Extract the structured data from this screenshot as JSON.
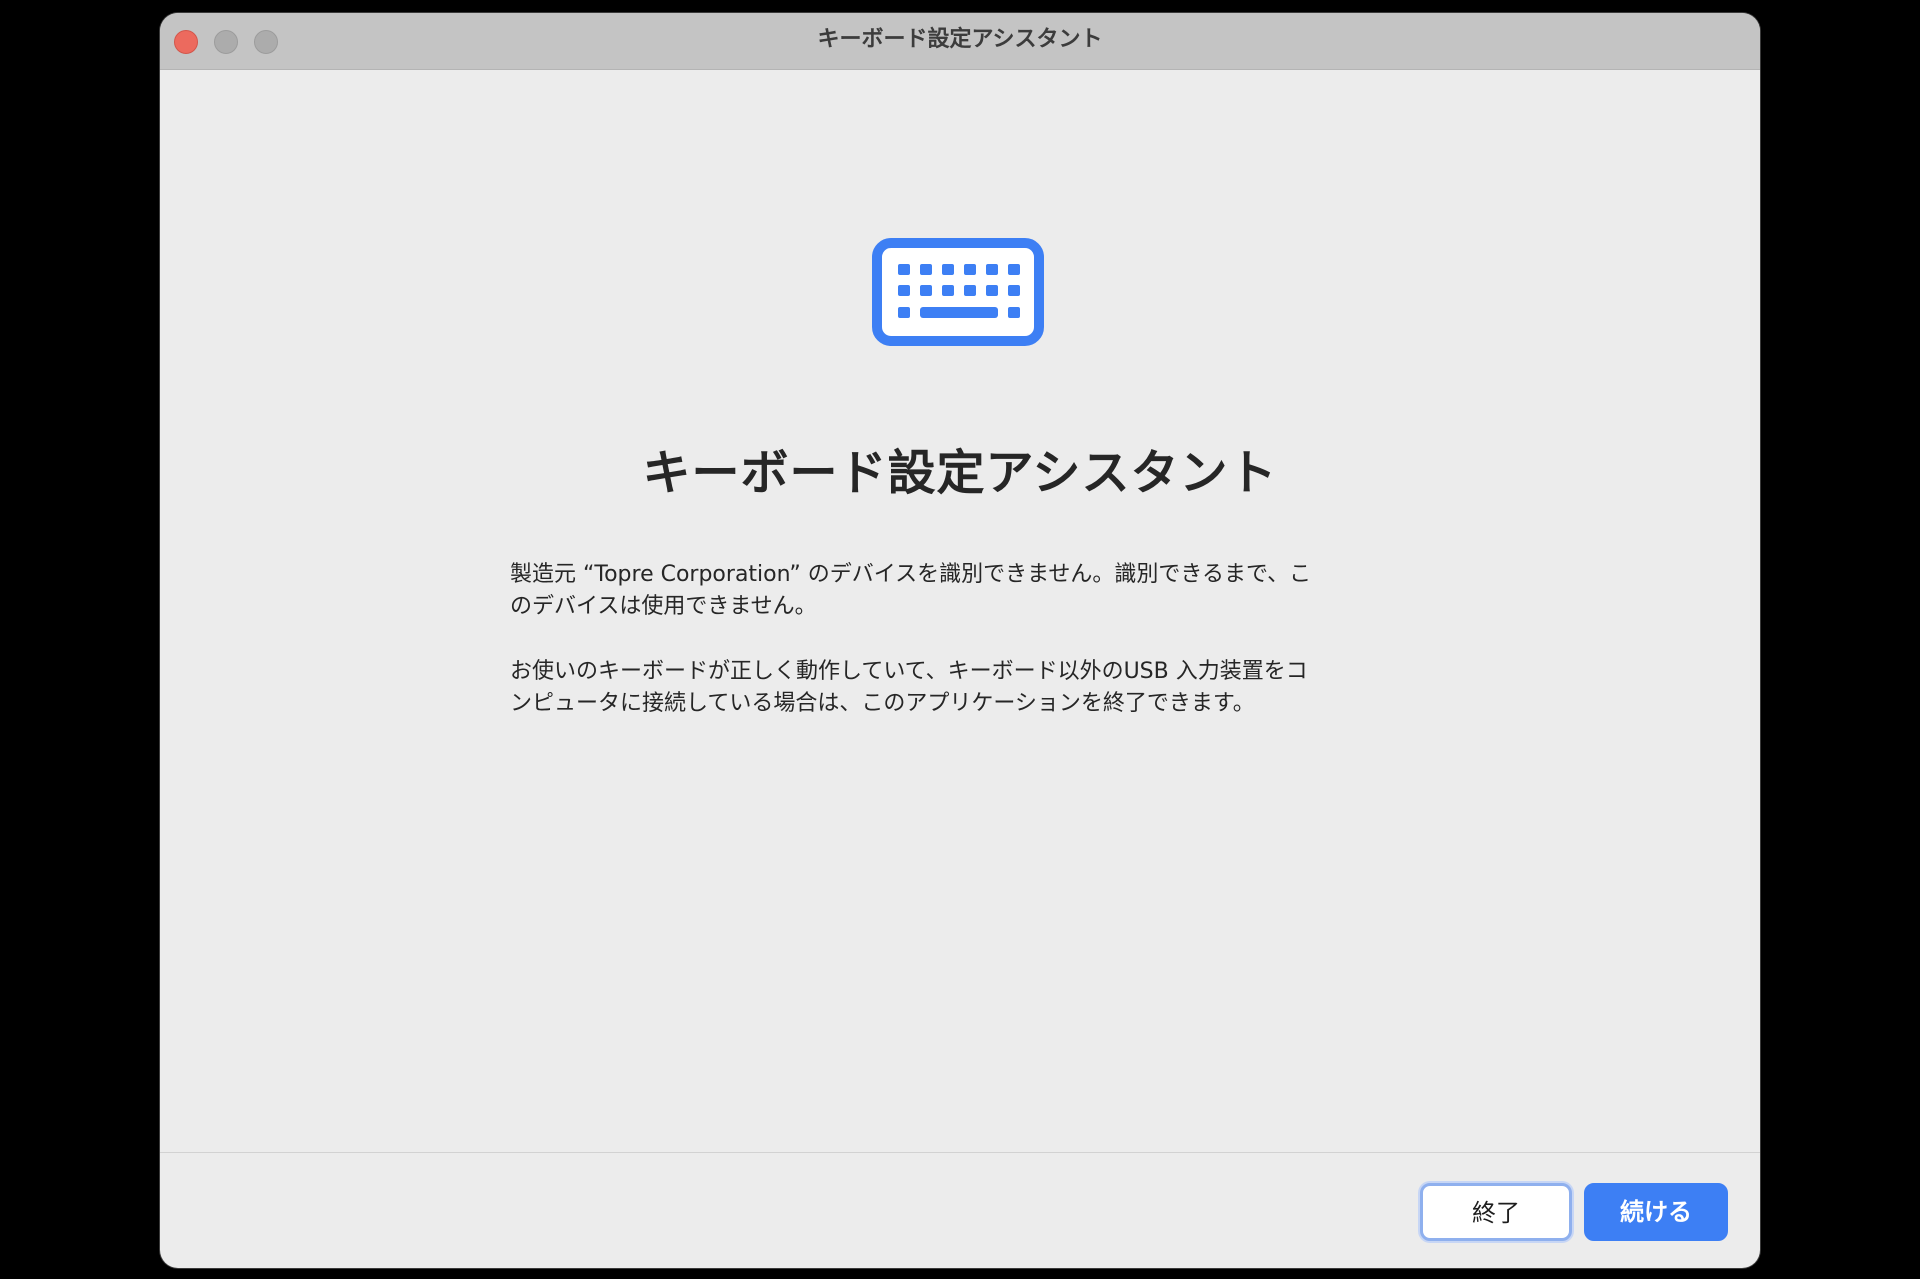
{
  "window": {
    "title": "キーボード設定アシスタント"
  },
  "main": {
    "icon": "keyboard-icon",
    "heading": "キーボード設定アシスタント",
    "paragraphs": [
      {
        "line1": "製造元 “Topre Corporation” のデバイスを識別できません。識別できるまで、こ",
        "line2": "のデバイスは使用できません。"
      },
      {
        "line1": "お使いのキーボードが正しく動作していて、キーボード以外のUSB 入力装置をコ",
        "line2": "ンピュータに接続している場合は、このアプリケーションを終了できます。"
      }
    ]
  },
  "footer": {
    "quit_label": "終了",
    "continue_label": "続ける"
  },
  "colors": {
    "accent": "#3d7ff4",
    "window_bg": "#ececec",
    "titlebar_bg": "#c4c4c4",
    "close_button": "#ec6a5e"
  }
}
